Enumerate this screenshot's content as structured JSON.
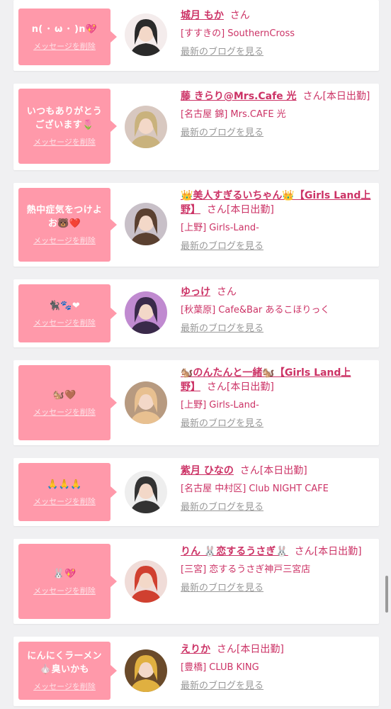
{
  "colors": {
    "pink_bubble": "#ff99aa",
    "name_text": "#cc3366",
    "blog_link": "#999999"
  },
  "icons": [
    "speech-bubble",
    "avatar-photo",
    "scroll-indicator"
  ],
  "cards": [
    {
      "bubble_text": "n( ･ ω ･ )n💖",
      "delete_label": "メッセージを削除",
      "name": "城月 もか",
      "suffix": "さん",
      "shop": "[すすきの] SouthernCross",
      "blog_label": "最新のブログを見る",
      "avatar_tone": [
        "#f4ecec",
        "#2a2a2a"
      ]
    },
    {
      "bubble_text": "いつもありがとう\nございます🌷",
      "delete_label": "メッセージを削除",
      "name": "藤 きらり@Mrs.Cafe 光",
      "suffix": "さん[本日出勤]",
      "shop": "[名古屋 錦] Mrs.CAFE 光",
      "blog_label": "最新のブログを見る",
      "avatar_tone": [
        "#d8c8c0",
        "#c9b27d"
      ]
    },
    {
      "bubble_text": "熱中症気をつけよ\nお🐻❤️",
      "delete_label": "メッセージを削除",
      "name": "👑美人すぎるいちゃん👑【Girls Land上野】",
      "suffix": "さん[本日出勤]",
      "shop": "[上野] Girls-Land-",
      "blog_label": "最新のブログを見る",
      "avatar_tone": [
        "#c8c0c8",
        "#5a4030"
      ]
    },
    {
      "bubble_text": "🐈‍⬛🐾❤",
      "delete_label": "メッセージを削除",
      "name": "ゆっけ",
      "suffix": "さん",
      "shop": "[秋葉原] Cafe&Bar あるこほりっく",
      "blog_label": "最新のブログを見る",
      "avatar_tone": [
        "#c08ad0",
        "#3a2a4a"
      ]
    },
    {
      "bubble_text": "🐿️🤎",
      "delete_label": "メッセージを削除",
      "name": "🐿️のんたんと一緒🐿️【Girls Land上野】",
      "suffix": "さん[本日出勤]",
      "shop": "[上野] Girls-Land-",
      "blog_label": "最新のブログを見る",
      "avatar_tone": [
        "#b79a80",
        "#e8c090"
      ]
    },
    {
      "bubble_text": "🙏🙏🙏",
      "delete_label": "メッセージを削除",
      "name": "紫月 ひなの",
      "suffix": "さん[本日出勤]",
      "shop": "[名古屋 中村区] Club NIGHT CAFE",
      "blog_label": "最新のブログを見る",
      "avatar_tone": [
        "#eeeeee",
        "#333333"
      ]
    },
    {
      "bubble_text": "🐰💖",
      "delete_label": "メッセージを削除",
      "name": "りん 🐰恋するうさぎ🐰",
      "suffix": "さん[本日出勤]",
      "shop": "[三宮] 恋するうさぎ神戸三宮店",
      "blog_label": "最新のブログを見る",
      "avatar_tone": [
        "#f0dcd8",
        "#d04030"
      ]
    },
    {
      "bubble_text": "にんにくラーメン\n🧄臭いかも",
      "delete_label": "メッセージを削除",
      "name": "えりか",
      "suffix": "さん[本日出勤]",
      "shop": "[豊橋] CLUB KING",
      "blog_label": "最新のブログを見る",
      "avatar_tone": [
        "#6a4a2a",
        "#e0b040"
      ]
    }
  ]
}
